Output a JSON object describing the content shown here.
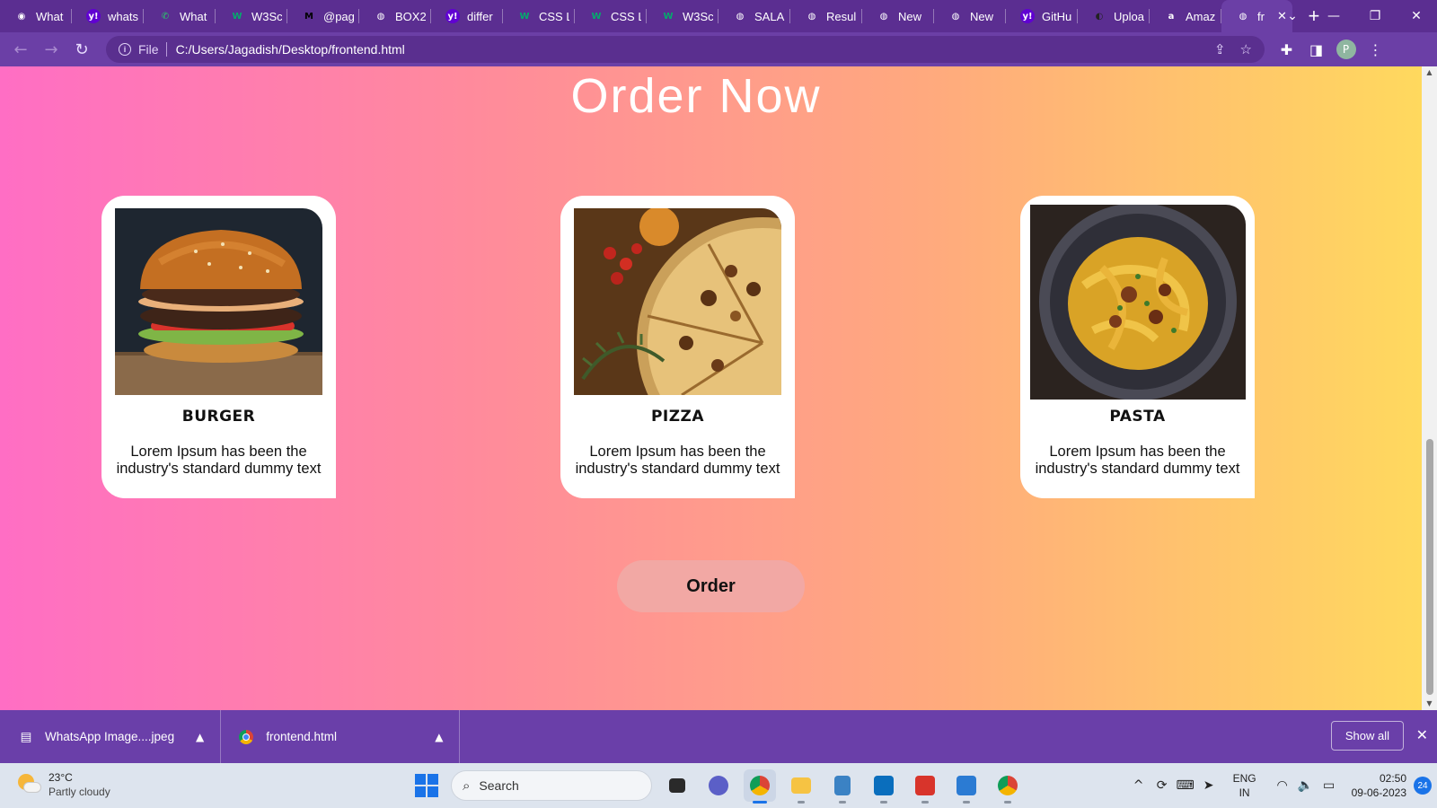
{
  "browser": {
    "tabs": [
      {
        "title": "What",
        "icon": "chrome-icon",
        "color": "#ffffff"
      },
      {
        "title": "whats",
        "icon": "yahoo-icon",
        "color": "#ffffff"
      },
      {
        "title": "What",
        "icon": "whatsapp-icon",
        "color": "#25d366"
      },
      {
        "title": "W3Sc",
        "icon": "w3schools-icon",
        "color": "#04aa6d"
      },
      {
        "title": "@pag",
        "icon": "medium-icon",
        "color": "#000000"
      },
      {
        "title": "BOX2",
        "icon": "globe-icon",
        "color": "#ffffff"
      },
      {
        "title": "differ",
        "icon": "yahoo-icon",
        "color": "#ffffff"
      },
      {
        "title": "CSS L",
        "icon": "w3schools-icon",
        "color": "#04aa6d"
      },
      {
        "title": "CSS L",
        "icon": "w3schools-icon",
        "color": "#04aa6d"
      },
      {
        "title": "W3Sc",
        "icon": "w3schools-icon",
        "color": "#04aa6d"
      },
      {
        "title": "SALA",
        "icon": "globe-icon",
        "color": "#ffffff"
      },
      {
        "title": "Resul",
        "icon": "globe-icon",
        "color": "#ffffff"
      },
      {
        "title": "New",
        "icon": "globe-icon",
        "color": "#ffffff"
      },
      {
        "title": "New",
        "icon": "globe-icon",
        "color": "#ffffff"
      },
      {
        "title": "GitHu",
        "icon": "yahoo-icon",
        "color": "#ffffff"
      },
      {
        "title": "Uploa",
        "icon": "github-icon",
        "color": "#222222"
      },
      {
        "title": "Amaz",
        "icon": "amazon-icon",
        "color": "#ffffff"
      },
      {
        "title": "fr",
        "icon": "globe-icon",
        "color": "#ffffff",
        "active": true
      }
    ],
    "address": {
      "scheme": "File",
      "url": "C:/Users/Jagadish/Desktop/frontend.html"
    },
    "profile_initial": "P"
  },
  "page": {
    "title": "Order Now",
    "cards": [
      {
        "name": "BURGER",
        "description": "Lorem Ipsum has been the industry's standard dummy text"
      },
      {
        "name": "PIZZA",
        "description": "Lorem Ipsum has been the industry's standard dummy text"
      },
      {
        "name": "PASTA",
        "description": "Lorem Ipsum has been the industry's standard dummy text"
      }
    ],
    "order_button": "Order",
    "gradient": [
      "#ff6ec4",
      "#ffa97e",
      "#ffd95e"
    ]
  },
  "downloads": {
    "items": [
      {
        "name": "WhatsApp Image....jpeg"
      },
      {
        "name": "frontend.html"
      }
    ],
    "show_all": "Show all"
  },
  "taskbar": {
    "weather": {
      "temp": "23°C",
      "condition": "Partly cloudy"
    },
    "search_placeholder": "Search",
    "lang_line1": "ENG",
    "lang_line2": "IN",
    "time": "02:50",
    "date": "09-06-2023",
    "notification_count": "24"
  }
}
